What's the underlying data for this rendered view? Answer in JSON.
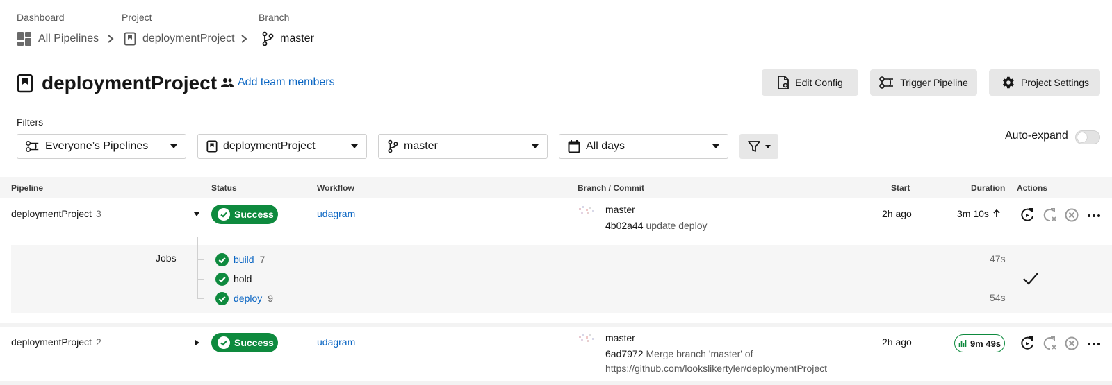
{
  "breadcrumb": {
    "dashboard_label": "Dashboard",
    "project_label": "Project",
    "branch_label": "Branch",
    "all_pipelines": "All Pipelines",
    "project": "deploymentProject",
    "branch": "master"
  },
  "header": {
    "title": "deploymentProject",
    "add_team": "Add team members",
    "edit_config": "Edit Config",
    "trigger_pipeline": "Trigger Pipeline",
    "project_settings": "Project Settings"
  },
  "filters": {
    "label": "Filters",
    "pipelines": "Everyone’s Pipelines",
    "project": "deploymentProject",
    "branch": "master",
    "days": "All days",
    "auto_expand": "Auto-expand"
  },
  "table": {
    "headers": {
      "pipeline": "Pipeline",
      "status": "Status",
      "workflow": "Workflow",
      "branch_commit": "Branch / Commit",
      "start": "Start",
      "duration": "Duration",
      "actions": "Actions"
    },
    "rows": [
      {
        "pipeline": "deploymentProject",
        "number": "3",
        "status": "Success",
        "workflow": "udagram",
        "branch": "master",
        "sha": "4b02a44",
        "message": "update deploy",
        "start": "2h ago",
        "duration": "3m 10s"
      },
      {
        "pipeline": "deploymentProject",
        "number": "2",
        "status": "Success",
        "workflow": "udagram",
        "branch": "master",
        "sha": "6ad7972",
        "message": "Merge branch 'master' of",
        "message_2": "https://github.com/lookslikertyler/deploymentProject",
        "start": "2h ago",
        "duration": "9m 49s"
      }
    ],
    "jobs_label": "Jobs",
    "jobs": [
      {
        "name": "build",
        "number": "7",
        "duration": "47s"
      },
      {
        "name": "hold",
        "number": "",
        "duration": ""
      },
      {
        "name": "deploy",
        "number": "9",
        "duration": "54s"
      }
    ]
  },
  "colors": {
    "success": "#0e8a3e",
    "link": "#0b66c3"
  }
}
